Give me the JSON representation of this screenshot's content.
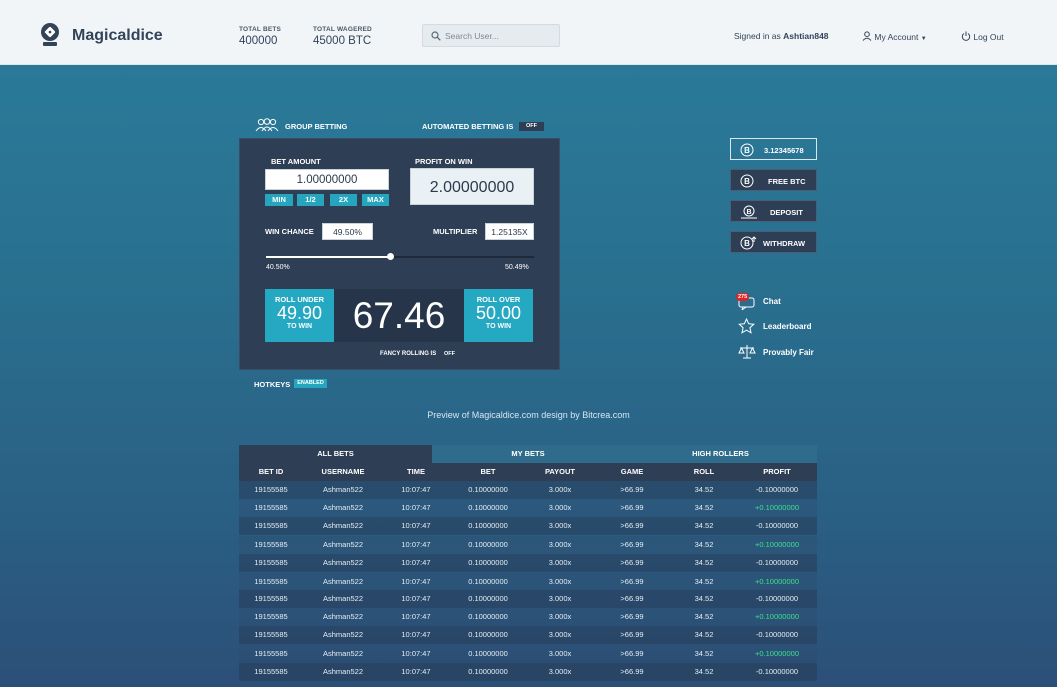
{
  "header": {
    "brand": "Magicaldice",
    "total_bets_label": "TOTAL BETS",
    "total_bets": "400000",
    "total_wagered_label": "TOTAL WAGERED",
    "total_wagered": "45000 BTC",
    "search_placeholder": "Search User...",
    "signed_in_prefix": "Signed in as",
    "username": "Ashtian848",
    "my_account": "My Account",
    "log_out": "Log Out"
  },
  "bet": {
    "group_betting": "GROUP BETTING",
    "automated_label": "AUTOMATED BETTING IS",
    "automated_state": "OFF",
    "bet_amount_label": "BET AMOUNT",
    "bet_amount": "1.00000000",
    "quick": [
      "MIN",
      "1/2",
      "2X",
      "MAX"
    ],
    "profit_label": "PROFIT ON WIN",
    "profit": "2.00000000",
    "win_chance_label": "WIN CHANCE",
    "win_chance": "49.50%",
    "multiplier_label": "MULTIPLIER",
    "multiplier": "1.25135X",
    "slider_min": "40.50%",
    "slider_max": "50.49%",
    "roll_under_label": "ROLL UNDER",
    "roll_under": "49.90",
    "to_win": "TO WIN",
    "result": "67.46",
    "roll_over_label": "ROLL OVER",
    "roll_over": "50.00",
    "fancy_label": "FANCY ROLLING IS",
    "fancy_state": "OFF",
    "hotkeys_label": "HOTKEYS",
    "hotkeys_state": "ENABLED"
  },
  "side": {
    "balance": "3.12345678",
    "free_btc": "FREE BTC",
    "deposit": "DEPOSIT",
    "withdraw": "WITHDRAW",
    "chat_badge": "275",
    "chat": "Chat",
    "leaderboard": "Leaderboard",
    "provably_fair": "Provably Fair"
  },
  "preview_note": "Preview of Magicaldice.com design by Bitcrea.com",
  "table": {
    "tabs": [
      "ALL BETS",
      "MY BETS",
      "HIGH ROLLERS"
    ],
    "columns": [
      "BET ID",
      "USERNAME",
      "TIME",
      "BET",
      "PAYOUT",
      "GAME",
      "ROLL",
      "PROFIT"
    ],
    "rows": [
      [
        "19155585",
        "Ashman522",
        "10:07:47",
        "0.10000000",
        "3.000x",
        ">66.99",
        "34.52",
        "-0.10000000"
      ],
      [
        "19155585",
        "Ashman522",
        "10:07:47",
        "0.10000000",
        "3.000x",
        ">66.99",
        "34.52",
        "+0.10000000"
      ],
      [
        "19155585",
        "Ashman522",
        "10:07:47",
        "0.10000000",
        "3.000x",
        ">66.99",
        "34.52",
        "-0.10000000"
      ],
      [
        "19155585",
        "Ashman522",
        "10:07:47",
        "0.10000000",
        "3.000x",
        ">66.99",
        "34.52",
        "+0.10000000"
      ],
      [
        "19155585",
        "Ashman522",
        "10:07:47",
        "0.10000000",
        "3.000x",
        ">66.99",
        "34.52",
        "-0.10000000"
      ],
      [
        "19155585",
        "Ashman522",
        "10:07:47",
        "0.10000000",
        "3.000x",
        ">66.99",
        "34.52",
        "+0.10000000"
      ],
      [
        "19155585",
        "Ashman522",
        "10:07:47",
        "0.10000000",
        "3.000x",
        ">66.99",
        "34.52",
        "-0.10000000"
      ],
      [
        "19155585",
        "Ashman522",
        "10:07:47",
        "0.10000000",
        "3.000x",
        ">66.99",
        "34.52",
        "+0.10000000"
      ],
      [
        "19155585",
        "Ashman522",
        "10:07:47",
        "0.10000000",
        "3.000x",
        ">66.99",
        "34.52",
        "-0.10000000"
      ],
      [
        "19155585",
        "Ashman522",
        "10:07:47",
        "0.10000000",
        "3.000x",
        ">66.99",
        "34.52",
        "+0.10000000"
      ],
      [
        "19155585",
        "Ashman522",
        "10:07:47",
        "0.10000000",
        "3.000x",
        ">66.99",
        "34.52",
        "-0.10000000"
      ]
    ]
  }
}
